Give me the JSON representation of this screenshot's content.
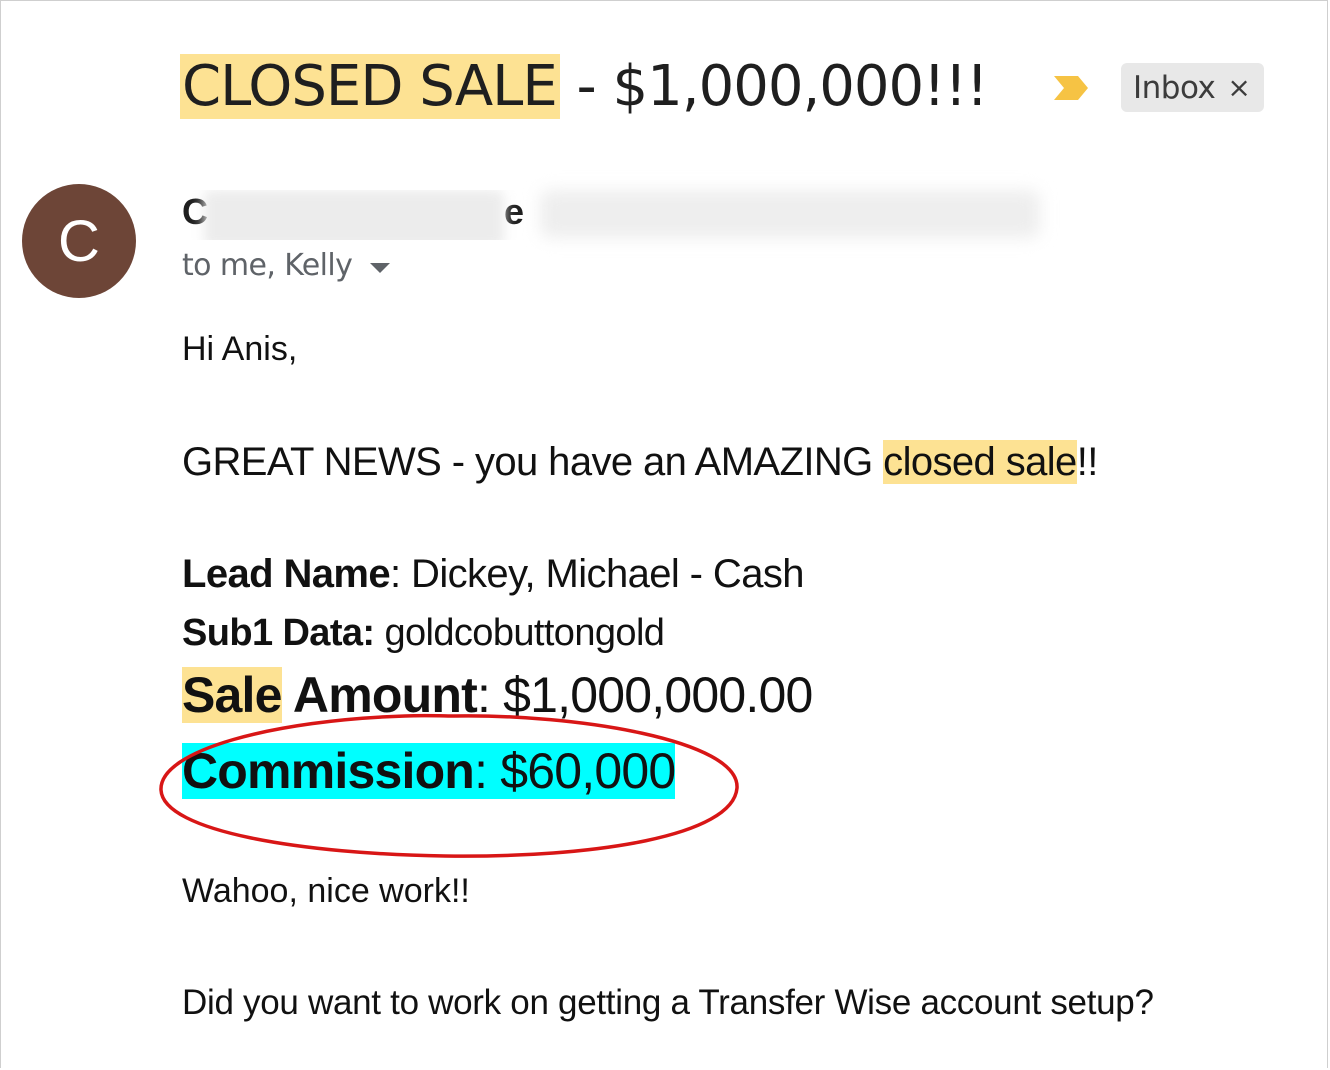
{
  "subject": {
    "highlighted": "CLOSED SALE",
    "rest": " - $1,000,000!!!"
  },
  "label_chip": {
    "label": "Inbox",
    "close": "×"
  },
  "sender": {
    "avatar_letter": "C",
    "name_first_visible": "C",
    "name_last_visible": "e",
    "recipients": "to me, Kelly"
  },
  "body": {
    "greeting": "Hi Anis,",
    "news_prefix": "GREAT NEWS - you have an AMAZING ",
    "news_highlight": "closed sale",
    "news_suffix": "!!",
    "lead_label": "Lead Name",
    "lead_value": ": Dickey, Michael - Cash",
    "sub1_label": "Sub1 Data:",
    "sub1_value": " goldcobuttongold",
    "sale_label_highlight": "Sale",
    "sale_label_rest": " Amount",
    "sale_value": ": $1,000,000.00",
    "commission_label": "Commission",
    "commission_value": ": $60,000",
    "wahoo": "Wahoo, nice work!!",
    "transfer": "Did you want to work on getting a Transfer Wise account setup?"
  },
  "colors": {
    "highlight_yellow": "#fde293",
    "highlight_cyan": "#00ffff",
    "avatar_bg": "#6d4537",
    "importance_marker": "#f6c344",
    "annotation_ellipse": "#d81616",
    "chip_bg": "#e8e8e8"
  },
  "icons": {
    "importance": "importance-marker-icon",
    "chip_close": "close-icon",
    "recipients_dropdown": "chevron-down-icon"
  }
}
